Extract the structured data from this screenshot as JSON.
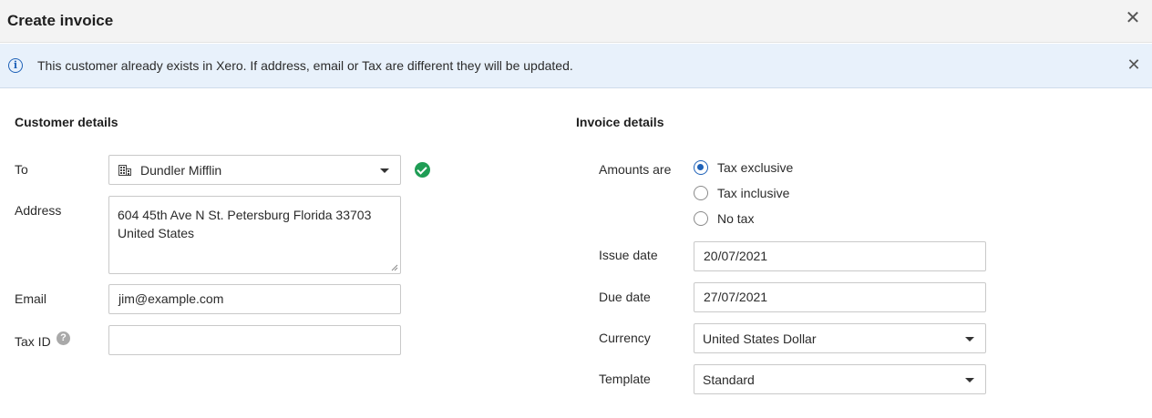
{
  "header": {
    "title": "Create invoice",
    "close_icon": "close-icon"
  },
  "banner": {
    "text": "This customer already exists in Xero. If address, email or Tax are different they will be updated.",
    "icon": "info-icon",
    "close_icon": "close-icon"
  },
  "customer": {
    "title": "Customer details",
    "to_label": "To",
    "to_value": "Dundler Mifflin",
    "address_label": "Address",
    "address_line1": "604 45th Ave N St. Petersburg Florida 33703",
    "address_line2": "United States",
    "email_label": "Email",
    "email_value": "jim@example.com",
    "taxid_label": "Tax ID",
    "taxid_value": "",
    "help_glyph": "?"
  },
  "invoice": {
    "title": "Invoice details",
    "amounts_label": "Amounts are",
    "amount_options": [
      "Tax exclusive",
      "Tax inclusive",
      "No tax"
    ],
    "amount_selected": "Tax exclusive",
    "issue_label": "Issue date",
    "issue_value": "20/07/2021",
    "due_label": "Due date",
    "due_value": "27/07/2021",
    "currency_label": "Currency",
    "currency_value": "United States Dollar",
    "template_label": "Template",
    "template_value": "Standard"
  },
  "colors": {
    "accent": "#1f62b8",
    "success": "#1f9d55",
    "banner_bg": "#e8f1fb"
  }
}
